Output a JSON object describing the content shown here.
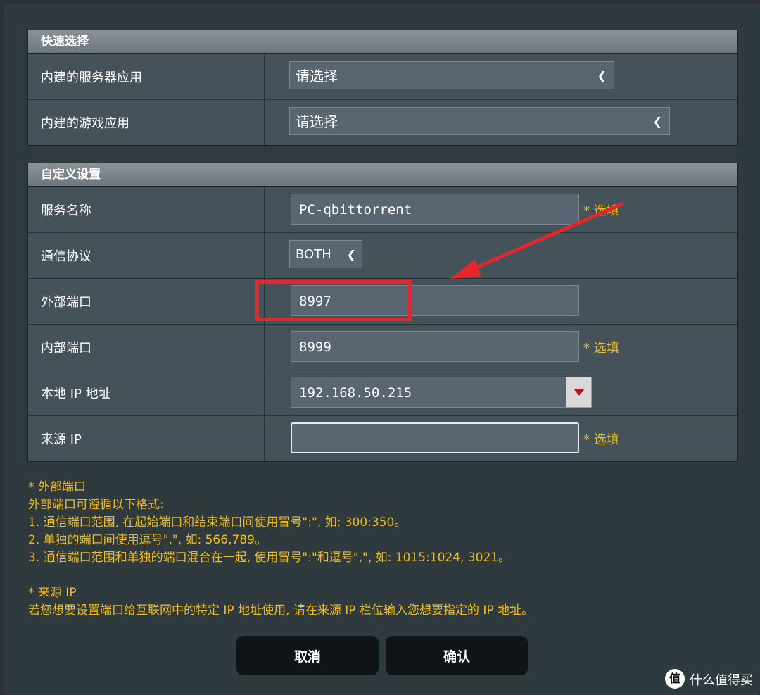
{
  "quick_select": {
    "header": "快速选择",
    "server_app": {
      "label": "内建的服务器应用",
      "value": "请选择"
    },
    "game_app": {
      "label": "内建的游戏应用",
      "value": "请选择"
    }
  },
  "custom": {
    "header": "自定义设置",
    "service_name": {
      "label": "服务名称",
      "value": "PC-qbittorrent",
      "hint": "* 选填"
    },
    "protocol": {
      "label": "通信协议",
      "value": "BOTH"
    },
    "external_port": {
      "label": "外部端口",
      "value": "8997"
    },
    "internal_port": {
      "label": "内部端口",
      "value": "8999",
      "hint": "* 选填"
    },
    "local_ip": {
      "label": "本地 IP 地址",
      "value": "192.168.50.215"
    },
    "source_ip": {
      "label": "来源 IP",
      "value": "",
      "hint": "* 选填"
    }
  },
  "notes": {
    "ext_title": "* 外部端口",
    "ext_intro": "外部端口可遵循以下格式:",
    "ext_1": "1. 通信端口范围, 在起始端口和结束端口间使用冒号\":\", 如: 300:350。",
    "ext_2": "2. 单独的端口间使用逗号\",\", 如: 566,789。",
    "ext_3": "3. 通信端口范围和单独的端口混合在一起, 使用冒号\":\"和逗号\",\", 如: 1015:1024, 3021。",
    "src_title": "* 来源 IP",
    "src_desc": "若您想要设置端口给互联网中的特定 IP 地址使用, 请在来源 IP 栏位输入您想要指定的 IP 地址。"
  },
  "buttons": {
    "cancel": "取消",
    "confirm": "确认"
  },
  "watermark": {
    "icon": "值",
    "text": "什么值得买"
  },
  "colors": {
    "accent": "#f2bd16",
    "annotation": "#e5262b"
  }
}
